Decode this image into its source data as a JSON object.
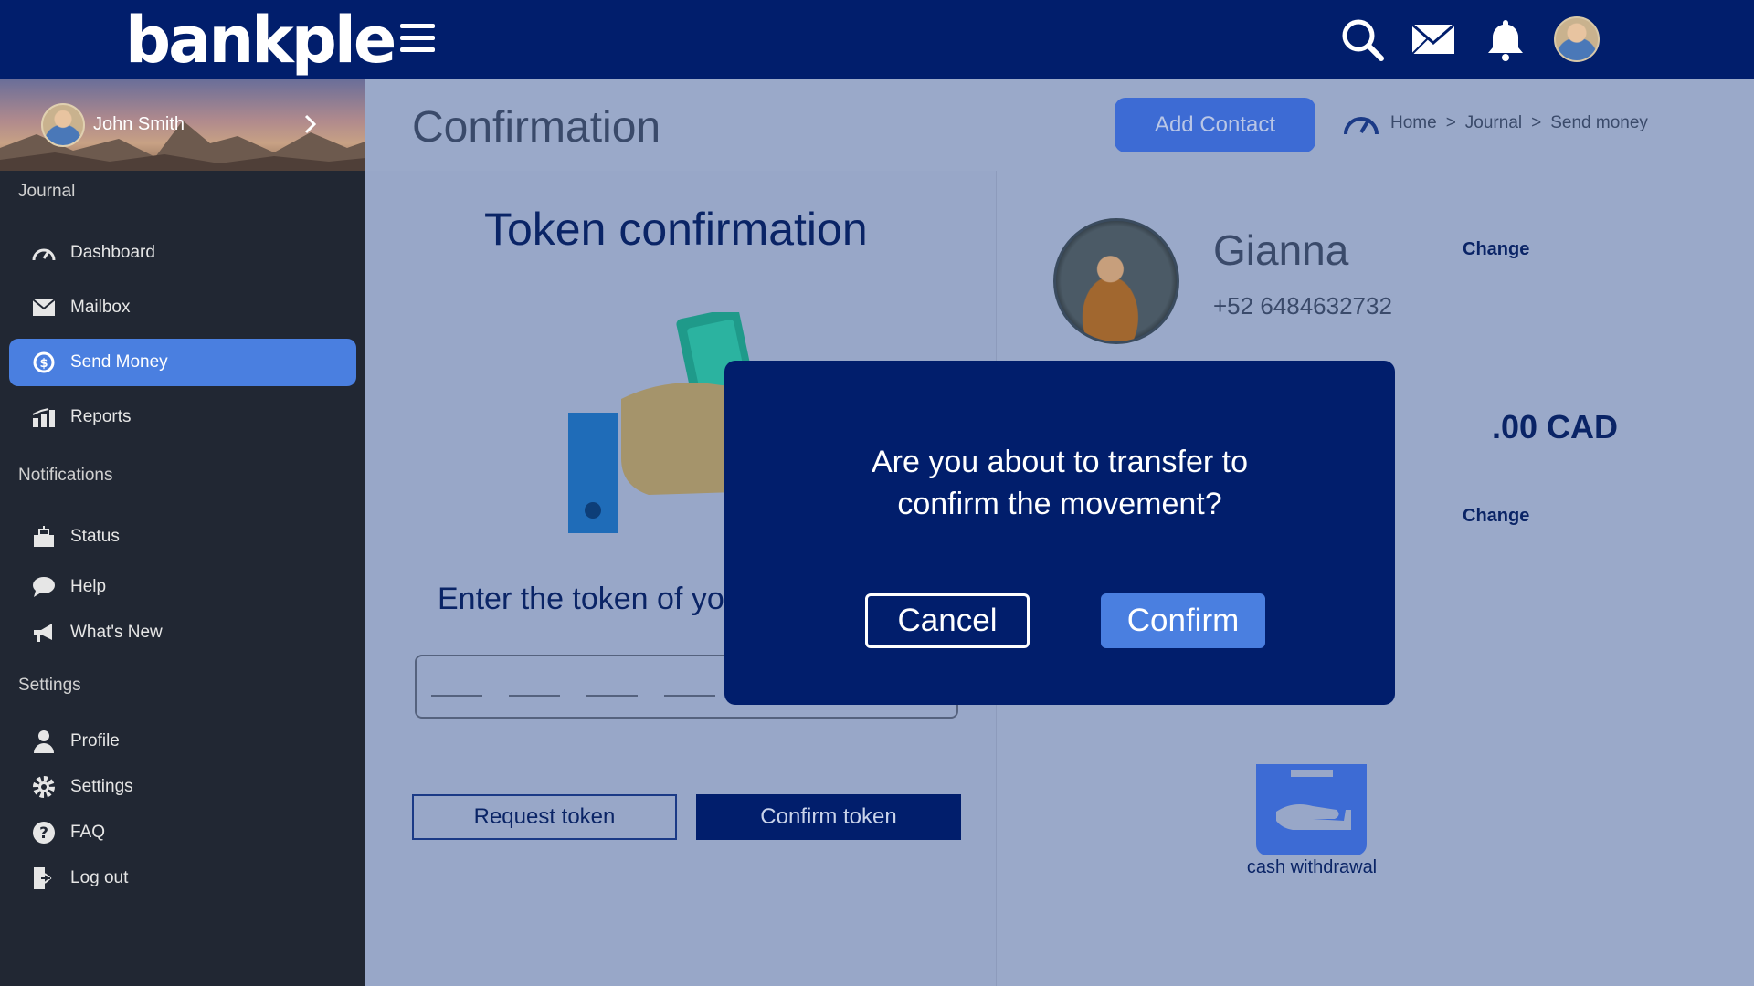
{
  "app": {
    "logo_text": "bankple"
  },
  "header": {
    "icons": [
      "search-icon",
      "mail-icon",
      "bell-icon",
      "avatar"
    ]
  },
  "sidebar": {
    "user_name": "John Smith",
    "sections": [
      {
        "title": "Journal",
        "items": [
          {
            "label": "Dashboard",
            "icon": "speedometer-icon"
          },
          {
            "label": "Mailbox",
            "icon": "mail-icon"
          },
          {
            "label": "Send Money",
            "icon": "money-transfer-icon",
            "active": true
          },
          {
            "label": "Reports",
            "icon": "chart-icon"
          }
        ]
      },
      {
        "title": "Notifications",
        "items": [
          {
            "label": "Status",
            "icon": "status-icon"
          },
          {
            "label": "Help",
            "icon": "chat-icon"
          },
          {
            "label": "What's New",
            "icon": "megaphone-icon"
          }
        ]
      },
      {
        "title": "Settings",
        "items": [
          {
            "label": "Profile",
            "icon": "user-icon"
          },
          {
            "label": "Settings",
            "icon": "gear-icon"
          },
          {
            "label": "FAQ",
            "icon": "question-icon"
          },
          {
            "label": "Log out",
            "icon": "logout-icon"
          }
        ]
      }
    ]
  },
  "main": {
    "title": "Confirmation",
    "add_contact": "Add Contact",
    "breadcrumb": [
      "Home",
      "Journal",
      "Send money"
    ],
    "breadcrumb_sep": ">",
    "token": {
      "title": "Token confirmation",
      "prompt": "Enter the token of yo",
      "request_button": "Request token",
      "confirm_button": "Confirm token"
    },
    "contact": {
      "name": "Gianna",
      "phone": "+52 6484632732",
      "change_label": "Change",
      "amount": ".00 CAD",
      "change_label_2": "Change",
      "method_label": "cash withdrawal"
    }
  },
  "modal": {
    "message": "Are you about to transfer to confirm the movement?",
    "cancel": "Cancel",
    "confirm": "Confirm"
  },
  "colors": {
    "topbar": "#011e6c",
    "sidebar": "#212733",
    "accent": "#4a7fe0",
    "overlay_bg": "#9aa9c9"
  }
}
